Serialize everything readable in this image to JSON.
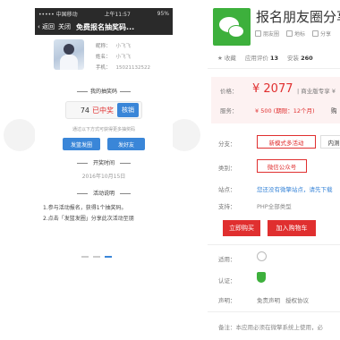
{
  "preview": {
    "status": {
      "carrier": "••••• 中国移动",
      "time": "上午11:57",
      "battery": "95%"
    },
    "nav": {
      "back": "返回",
      "close": "关闭",
      "title": "免费报名抽奖码..."
    },
    "profile": {
      "nickname_label": "昵称：",
      "nickname": "小飞飞",
      "name_label": "姓名：",
      "name": "小飞飞",
      "phone_label": "手机：",
      "phone": "15021132522"
    },
    "code_section": "我的抽奖码",
    "code_number": "74",
    "code_status": "已中奖",
    "verify_button": "核销",
    "hint": "通过以下方式可获得更多抽奖码",
    "btn_moments": "发篮发圈",
    "btn_friend": "发好友",
    "draw_time_title": "开奖时间",
    "draw_date": "2016年10月15日",
    "rules_title": "活动说明",
    "rule1": "1.参与活动报名，获得1个抽奖码。",
    "rule2": "2.点击「发篮发圈」分享此次活动至朋"
  },
  "product": {
    "title": "报名朋友圈分享",
    "tags": [
      "朋友圈",
      "地标",
      "分享"
    ],
    "favorite": "收藏",
    "rating_label": "应用评价",
    "rating_value": "13",
    "install_label": "安装",
    "install_value": "260",
    "price_label": "价格：",
    "price_value": "¥ 2077",
    "price_extra": "| 商业版专享 ¥",
    "service_label": "服务：",
    "service_value": "¥ 500 (期限：12个月)",
    "service_more": "购",
    "branch_label": "分支：",
    "branch_options": [
      "新模式多活动",
      "内测"
    ],
    "category_label": "类别：",
    "category_value": "微信公众号",
    "site_label": "站点：",
    "site_text": "您还没有微擎站点，请先下载",
    "support_label": "支持：",
    "support_text": "PHP全部类型",
    "buy_now": "立即购买",
    "add_cart": "加入购物车",
    "platform_label": "适用：",
    "cert_label": "认证：",
    "statement_label": "声明：",
    "statement_links": [
      "免责声明",
      "授权协议"
    ],
    "note": "备注：本应用必须在微擎系统上使用，必"
  },
  "colors": {
    "accent_red": "#e02f2f",
    "accent_blue": "#3a86d8",
    "wechat_green": "#3db03c"
  }
}
